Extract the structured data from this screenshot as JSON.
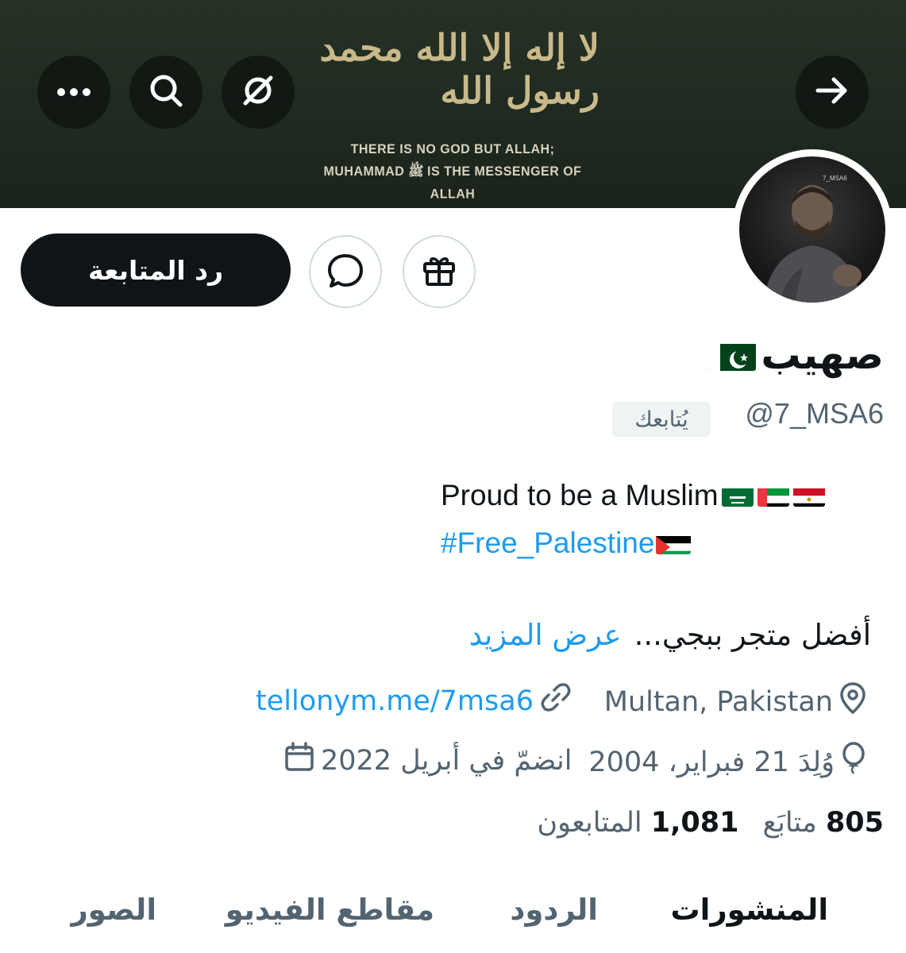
{
  "banner": {
    "calligraphy": "لا إله إلا الله محمد رسول الله",
    "caption_line1": "THERE IS NO GOD BUT ALLAH;",
    "caption_line2": "MUHAMMAD ﷺ IS THE MESSENGER OF ALLAH"
  },
  "nav": {
    "back_icon": "arrow-right-icon",
    "grok_icon": "grok-icon",
    "search_icon": "search-icon",
    "more_icon": "more-icon"
  },
  "avatar": {
    "watermark": "7_MSA6"
  },
  "actions": {
    "follow_back_label": "رد المتابعة",
    "message_icon": "message-icon",
    "gift_icon": "gift-icon"
  },
  "profile": {
    "display_name": "صهيب",
    "handle": "@7_MSA6",
    "follows_you": "يُتابعك",
    "bio_line1": "Proud to be a Muslim",
    "bio_hashtag": "#Free_Palestine",
    "bio_arabic": "أفضل متجر ببجي...",
    "show_more": "عرض المزيد",
    "location": "Multan, Pakistan",
    "website": "tellonym.me/7msa6",
    "birthday": "وُلِدَ 21 فبراير، 2004",
    "joined": "انضمّ في أبريل 2022"
  },
  "stats": {
    "following_count": "805",
    "following_label": "متابَع",
    "followers_count": "1,081",
    "followers_label": "المتابعون"
  },
  "tabs": {
    "posts": "المنشورات",
    "replies": "الردود",
    "videos": "مقاطع الفيديو",
    "photos": "الصور"
  },
  "colors": {
    "accent": "#1d9bf0",
    "text": "#0f1419",
    "secondary": "#536471",
    "banner": "#1f2a20",
    "gold": "#c9b98a"
  }
}
